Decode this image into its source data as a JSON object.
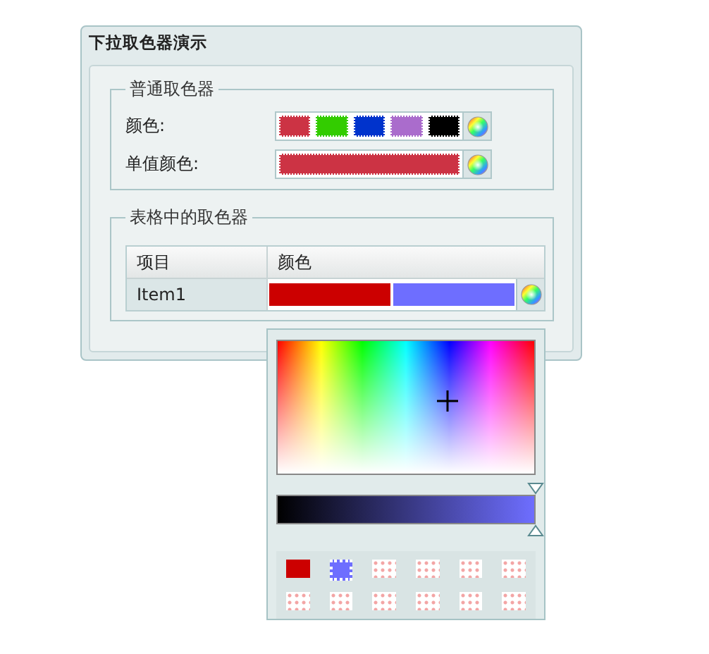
{
  "panel": {
    "title": "下拉取色器演示"
  },
  "plain_group": {
    "legend": "普通取色器",
    "rows": [
      {
        "label": "颜色:",
        "swatches": [
          {
            "color": "#cc3344"
          },
          {
            "color": "#33cc00"
          },
          {
            "color": "#0033cc"
          },
          {
            "color": "#aa6ccc"
          },
          {
            "color": "#000000"
          }
        ]
      },
      {
        "label": "单值颜色:",
        "swatches": [
          {
            "color": "#cc3344"
          }
        ]
      }
    ]
  },
  "table_group": {
    "legend": "表格中的取色器",
    "columns": [
      "项目",
      "颜色"
    ],
    "rows": [
      {
        "item": "Item1",
        "colors": [
          {
            "color": "#cc0000"
          },
          {
            "color": "#6e6eff"
          }
        ]
      }
    ]
  },
  "popup": {
    "brightness": {
      "level": 1
    },
    "swatches": [
      {
        "kind": "filled",
        "color": "#cc0000",
        "selected": false
      },
      {
        "kind": "filled",
        "color": "#6e6eff",
        "selected": true
      },
      {
        "kind": "empty",
        "selected": false
      },
      {
        "kind": "empty",
        "selected": false
      },
      {
        "kind": "empty",
        "selected": false
      },
      {
        "kind": "empty",
        "selected": false
      },
      {
        "kind": "empty",
        "selected": false
      },
      {
        "kind": "empty",
        "selected": false
      },
      {
        "kind": "empty",
        "selected": false
      },
      {
        "kind": "empty",
        "selected": false
      },
      {
        "kind": "empty",
        "selected": false
      },
      {
        "kind": "empty",
        "selected": false
      }
    ]
  }
}
